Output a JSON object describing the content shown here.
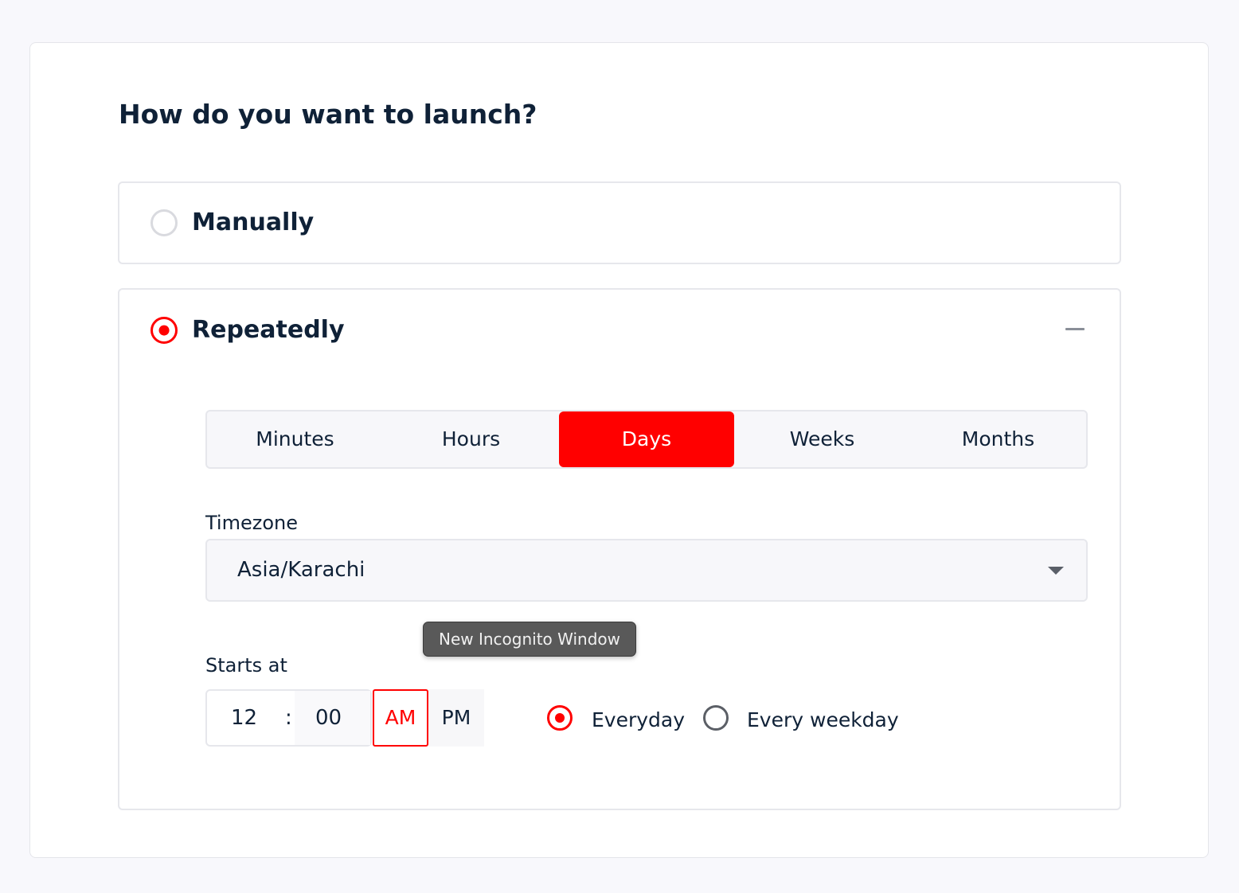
{
  "page": {
    "title": "How do you want to launch?"
  },
  "launch_options": {
    "manual": {
      "label": "Manually",
      "selected": false
    },
    "repeat": {
      "label": "Repeatedly",
      "selected": true,
      "expanded": true
    }
  },
  "interval_tabs": [
    {
      "label": "Minutes",
      "active": false
    },
    {
      "label": "Hours",
      "active": false
    },
    {
      "label": "Days",
      "active": true
    },
    {
      "label": "Weeks",
      "active": false
    },
    {
      "label": "Months",
      "active": false
    }
  ],
  "timezone": {
    "label": "Timezone",
    "value": "Asia/Karachi"
  },
  "tooltip": {
    "text": "New Incognito Window"
  },
  "start": {
    "label": "Starts at",
    "hour": "12",
    "separator": ":",
    "minute": "00",
    "am_label": "AM",
    "pm_label": "PM",
    "meridiem_selected": "AM"
  },
  "frequency": {
    "everyday_label": "Everyday",
    "weekday_label": "Every weekday",
    "selected": "Everyday"
  },
  "colors": {
    "accent": "#ff0000",
    "text": "#0f2137",
    "border": "#e6e7ec",
    "background": "#f8f8fc"
  },
  "icons": {
    "collapse": "minus-icon",
    "dropdown": "caret-down-icon"
  }
}
